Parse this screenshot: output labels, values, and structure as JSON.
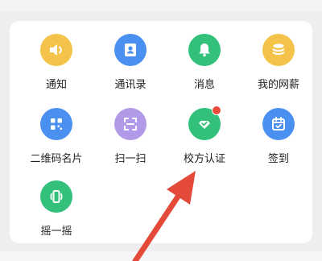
{
  "apps": [
    {
      "label": "通知",
      "icon": "speaker-icon",
      "color": "#f5c24a"
    },
    {
      "label": "通讯录",
      "icon": "contact-card-icon",
      "color": "#4a90f0"
    },
    {
      "label": "消息",
      "icon": "bell-icon",
      "color": "#33c07a"
    },
    {
      "label": "我的网薪",
      "icon": "coins-icon",
      "color": "#f5c24a"
    },
    {
      "label": "二维码名片",
      "icon": "qr-code-icon",
      "color": "#4a90f0"
    },
    {
      "label": "扫一扫",
      "icon": "scan-icon",
      "color": "#b39ae8"
    },
    {
      "label": "校方认证",
      "icon": "verified-check-icon",
      "color": "#33c07a",
      "badge": true
    },
    {
      "label": "签到",
      "icon": "calendar-check-icon",
      "color": "#4a90f0"
    },
    {
      "label": "摇一摇",
      "icon": "phone-shake-icon",
      "color": "#33c07a"
    }
  ],
  "annotation": {
    "color": "#e34a3a"
  }
}
